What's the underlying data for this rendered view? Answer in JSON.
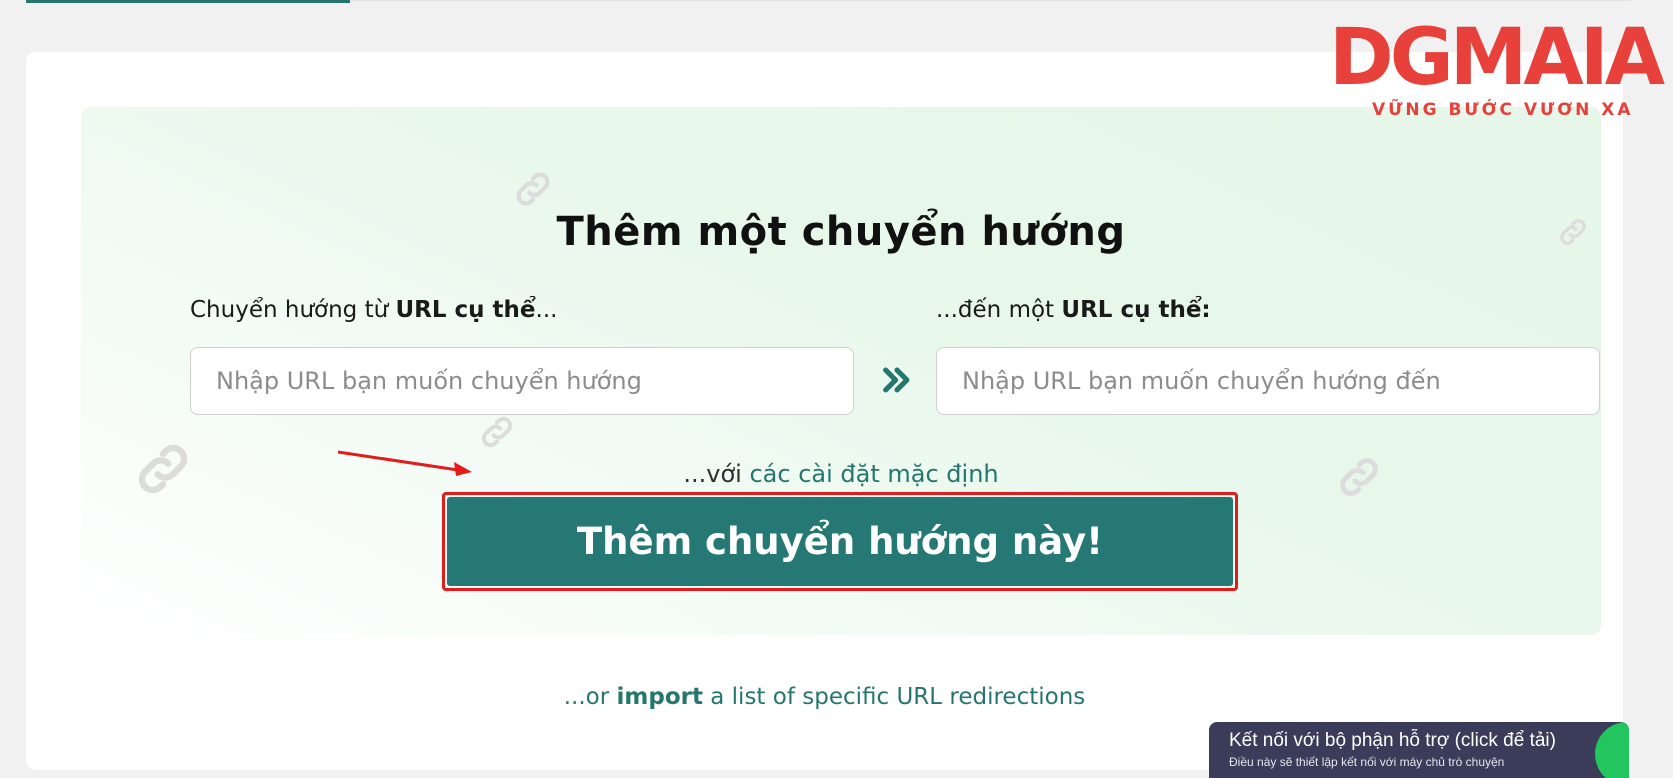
{
  "logo": {
    "main": "DGMAIA",
    "tagline": "VỮNG BƯỚC VƯƠN XA"
  },
  "form": {
    "title": "Thêm một chuyển hướng",
    "from_label_prefix": "Chuyển hướng từ ",
    "from_label_bold": "URL cụ thể",
    "from_label_suffix": "...",
    "to_label_prefix": "...đến một ",
    "to_label_bold": "URL cụ thể:",
    "from_placeholder": "Nhập URL bạn muốn chuyển hướng",
    "to_placeholder": "Nhập URL bạn muốn chuyển hướng đến",
    "arrow_icon": "double-chevron-right-icon",
    "defaults_prefix": "...với ",
    "defaults_link": "các cài đặt mặc định",
    "submit_label": "Thêm chuyển hướng này!"
  },
  "import": {
    "prefix": "...or ",
    "link": "import",
    "suffix": " a list of specific URL redirections"
  },
  "support": {
    "title": "Kết nối với bộ phận hỗ trợ (click để tải)",
    "subtitle": "Điều này sẽ thiết lập kết nối với máy chủ trò chuyện"
  },
  "colors": {
    "accent": "#25776d",
    "button": "#257873",
    "highlight": "#e41b1b",
    "logo": "#e8403b",
    "support_bg": "#3a3c5a"
  }
}
